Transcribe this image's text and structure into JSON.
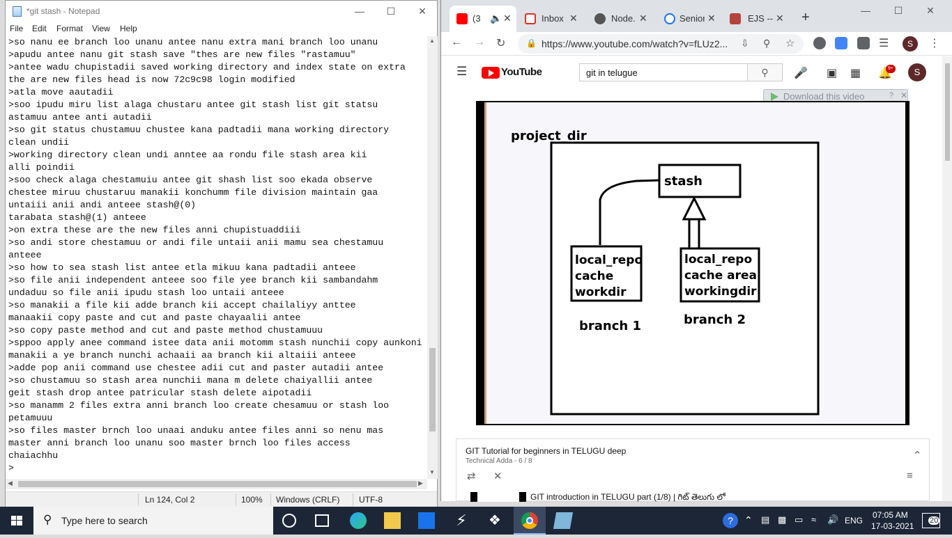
{
  "notepad": {
    "title": "*git stash - Notepad",
    "menu": [
      "File",
      "Edit",
      "Format",
      "View",
      "Help"
    ],
    "lines": [
      ">so nanu ee branch loo unanu antee nanu extra mani branch loo unanu",
      ">apudu antee nanu git stash save \"thes are new files \"rastamuu\"",
      ">antee wadu chupistadii saved working directory and index state on extra",
      "the are new files head is now 72c9c98 login modified",
      ">atla move aautadii",
      ">soo ipudu miru list alaga chustaru antee git stash list git statsu",
      "astamuu antee anti autadii",
      ">so git status chustamuu chustee kana padtadii mana working directory",
      "clean undii",
      ">working directory clean undi anntee aa rondu file stash area kii",
      "alli poindii",
      ">soo check alaga chestamuiu antee git shash list soo ekada observe",
      "chestee miruu chustaruu manakii konchumm file division maintain gaa",
      "untaiii anii andi anteee stash@(0)",
      "tarabata stash@(1) anteee",
      ">on extra these are the new files anni chupistuaddiii",
      ">so andi store chestamuu or andi file untaii anii mamu sea chestamuu",
      "anteee",
      ">so how to sea stash list antee etla mikuu kana padtadii anteee",
      ">so file anii independent anteee soo file yee branch kii sambandahm",
      "undaduu so file anii ipudu stash loo untaii anteee",
      ">so manakii a file kii adde branch kii accept chailaliyy anttee",
      "manaakii copy paste and cut and paste chayaalii antee",
      ">so copy paste method and cut and paste method chustamuuu",
      ">sppoo apply anee command istee data anii motomm stash nunchii copy aunkoni",
      "manakii a ye branch nunchi achaaii aa branch kii altaiii anteee",
      ">adde pop anii command use chestee adii cut and paster autadii antee",
      ">so chustamuu so stash area nunchii mana m delete chaiyallii antee",
      "geit stash drop antee patricular stash delete aipotadii",
      ">so manamm 2 files extra anni branch loo create chesamuu or stash loo",
      "petamuuu",
      ">so files master brnch loo unaai anduku antee files anni so nenu mas",
      "master anni branch loo unanu soo master brnch loo files access",
      "chaiachhu",
      ">"
    ],
    "status": {
      "position": "Ln 124, Col 2",
      "zoom": "100%",
      "line_endings": "Windows (CRLF)",
      "encoding": "UTF-8"
    }
  },
  "browser": {
    "tabs": [
      {
        "label": "(3",
        "icon": "youtube-icon",
        "active": true
      },
      {
        "label": "Inbox",
        "icon": "gmail-icon"
      },
      {
        "label": "Node.",
        "icon": "node-icon"
      },
      {
        "label": "Senior",
        "icon": "info-icon"
      },
      {
        "label": "EJS --",
        "icon": "ejs-icon"
      }
    ],
    "url": "https://www.youtube.com/watch?v=fLUz2...",
    "profile_initial": "S"
  },
  "youtube": {
    "logo_text": "YouTube",
    "search_value": "git in telugue",
    "notification_count": "9+",
    "avatar_initial": "S",
    "download_overlay": "Download this video",
    "slide": {
      "title": "project_dir",
      "stash_label": "stash",
      "branch1_box": [
        "local_repo",
        "cache",
        "workdir"
      ],
      "branch1_label": "branch 1",
      "branch2_box": [
        "local_repo",
        "cache area",
        "workingdir"
      ],
      "branch2_label": "branch 2"
    },
    "playlist": {
      "title": "GIT Tutorial for beginners in TELUGU deep",
      "subtitle": "Technical Adda - 6 / 8",
      "current_item": "GIT introduction in TELUGU part (1/8) | గిట్ తెలుగు లో"
    }
  },
  "taskbar": {
    "search_placeholder": "Type here to search",
    "language": "ENG",
    "time": "07:05 AM",
    "date": "17-03-2021",
    "notifications": "20"
  }
}
